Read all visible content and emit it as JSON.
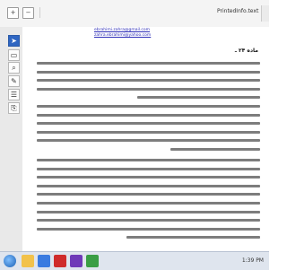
{
  "toolbar": {
    "page_count": "PrintedInfo.text",
    "buttons": [
      "zoom-in-icon",
      "zoom-out-icon"
    ]
  },
  "sidebar": {
    "icons": [
      "select-icon",
      "page-icon",
      "search-icon",
      "bookmark-icon",
      "layers-icon",
      "attach-icon"
    ]
  },
  "document": {
    "emails": [
      "ebrahimi.zahra@gmail.com",
      "zahra.ebrahimi@yahoo.com"
    ],
    "heading": "ماده ۲۴ ـ"
  },
  "taskbar": {
    "time": "1:39 PM"
  }
}
